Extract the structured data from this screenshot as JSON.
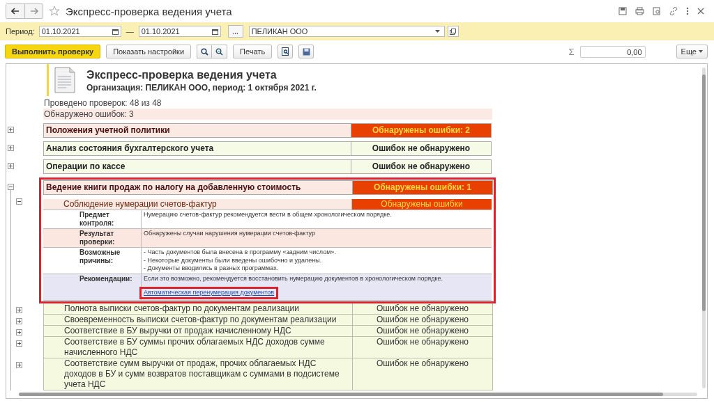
{
  "window": {
    "title": "Экспресс-проверка ведения учета"
  },
  "filter": {
    "period_label": "Период:",
    "date_from": "01.10.2021",
    "separator": "—",
    "date_to": "01.10.2021",
    "more_button": "...",
    "organization": "ПЕЛИКАН ООО"
  },
  "toolbar": {
    "run_button": "Выполнить проверку",
    "settings_button": "Показать настройки",
    "print_button": "Печать",
    "sum_sign": "Σ",
    "sum_value": "0,00",
    "more_button": "Еще"
  },
  "report": {
    "title": "Экспресс-проверка ведения учета",
    "subtitle": "Организация: ПЕЛИКАН ООО, период: 1 октября 2021 г.",
    "checks_done": "Проведено проверок: 48 из 48",
    "errors_found": "Обнаружено ошибок: 3",
    "sections": [
      {
        "title": "Положения учетной политики",
        "status": "Обнаружены ошибки: 2",
        "has_errors": true,
        "expanded": false,
        "highlighted": false
      },
      {
        "title": "Анализ состояния бухгалтерского учета",
        "status": "Ошибок не обнаружено",
        "has_errors": false,
        "expanded": false,
        "highlighted": false
      },
      {
        "title": "Операции по кассе",
        "status": "Ошибок не обнаружено",
        "has_errors": false,
        "expanded": false,
        "highlighted": false
      },
      {
        "title": "Ведение книги продаж по налогу на добавленную стоимость",
        "status": "Обнаружены ошибки: 1",
        "has_errors": true,
        "expanded": true,
        "highlighted": true,
        "children": [
          {
            "title": "Соблюдение нумерации счетов-фактур",
            "status": "Обнаружены ошибки",
            "has_errors": true,
            "expanded": true,
            "highlighted": true,
            "details": [
              {
                "kind": "subject",
                "label": "Предмет контроля:",
                "lines": [
                  "Нумерацию счетов-фактур рекомендуется вести в общем хронологическом порядке."
                ]
              },
              {
                "kind": "result",
                "label": "Результат проверки:",
                "lines": [
                  "Обнаружены случаи нарушения нумерации счетов-фактур"
                ]
              },
              {
                "kind": "causes",
                "label": "Возможные причины:",
                "lines": [
                  "- Часть документов была внесена в программу «задним числом».",
                  "- Некоторые документы были введены ошибочно и удалены.",
                  "- Документы вводились в разных программах."
                ]
              },
              {
                "kind": "recommendation",
                "label": "Рекомендации:",
                "lines": [
                  "Если это возможно, рекомендуется восстановить нумерацию документов в хронологическом порядке."
                ],
                "link": "Автоматическая перенумерация документов",
                "link_highlighted": true
              }
            ]
          },
          {
            "title": "Полнота выписки счетов-фактур по документам реализации",
            "status": "Ошибок не обнаружено",
            "has_errors": false,
            "expanded": false,
            "highlighted": false
          },
          {
            "title": "Своевременность выписки счетов-фактур по документам реализации",
            "status": "Ошибок не обнаружено",
            "has_errors": false,
            "expanded": false,
            "highlighted": false
          },
          {
            "title": "Соответствие в БУ выручки от продаж начисленному НДС",
            "status": "Ошибок не обнаружено",
            "has_errors": false,
            "expanded": false,
            "highlighted": false
          },
          {
            "title": "Соответствие в БУ суммы прочих облагаемых НДС доходов сумме начисленного НДС",
            "status": "Ошибок не обнаружено",
            "has_errors": false,
            "expanded": false,
            "highlighted": false
          },
          {
            "title": "Соответствие сумм выручки от продаж, прочих облагаемых НДС доходов в БУ и сумм возвратов поставщикам с суммами в подсистеме учета НДС",
            "status": "Ошибок не обнаружено",
            "has_errors": false,
            "expanded": false,
            "highlighted": false
          }
        ]
      }
    ]
  }
}
